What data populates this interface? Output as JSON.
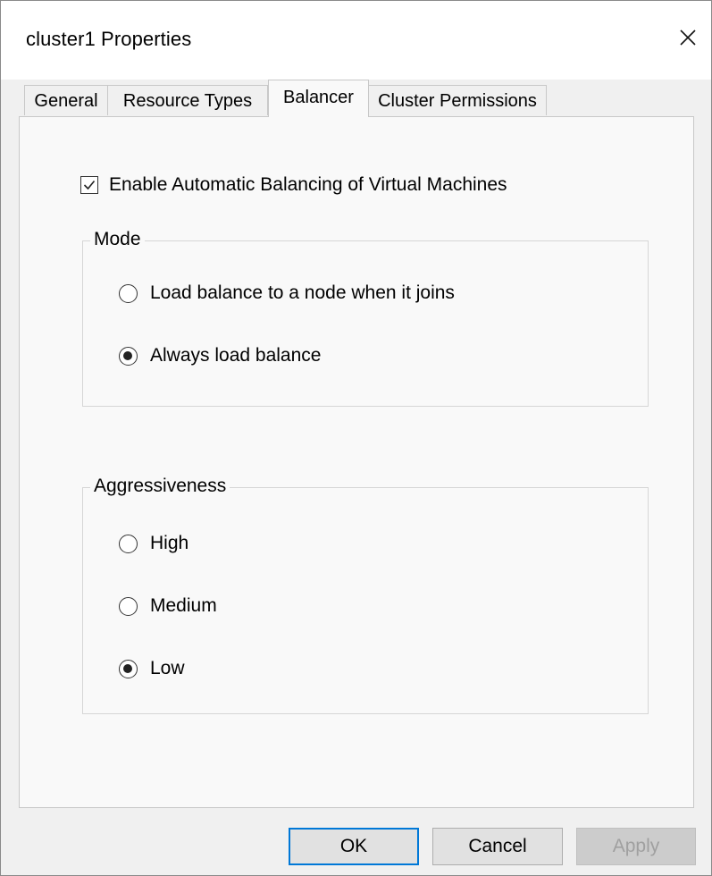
{
  "window": {
    "title": "cluster1 Properties",
    "close_icon": "close-icon"
  },
  "tabs": [
    {
      "label": "General",
      "active": false
    },
    {
      "label": "Resource Types",
      "active": false
    },
    {
      "label": "Balancer",
      "active": true
    },
    {
      "label": "Cluster Permissions",
      "active": false
    }
  ],
  "balancer": {
    "enable_label": "Enable Automatic Balancing of Virtual Machines",
    "enable_checked": true,
    "mode": {
      "legend": "Mode",
      "options": [
        {
          "label": "Load balance to a node when it joins",
          "checked": false
        },
        {
          "label": "Always load balance",
          "checked": true
        }
      ]
    },
    "aggressiveness": {
      "legend": "Aggressiveness",
      "options": [
        {
          "label": "High",
          "checked": false
        },
        {
          "label": "Medium",
          "checked": false
        },
        {
          "label": "Low",
          "checked": true
        }
      ]
    }
  },
  "buttons": {
    "ok": "OK",
    "cancel": "Cancel",
    "apply": "Apply",
    "apply_enabled": false
  },
  "colors": {
    "accent": "#0078d7",
    "panel": "#f9f9f9",
    "chrome": "#f0f0f0"
  }
}
